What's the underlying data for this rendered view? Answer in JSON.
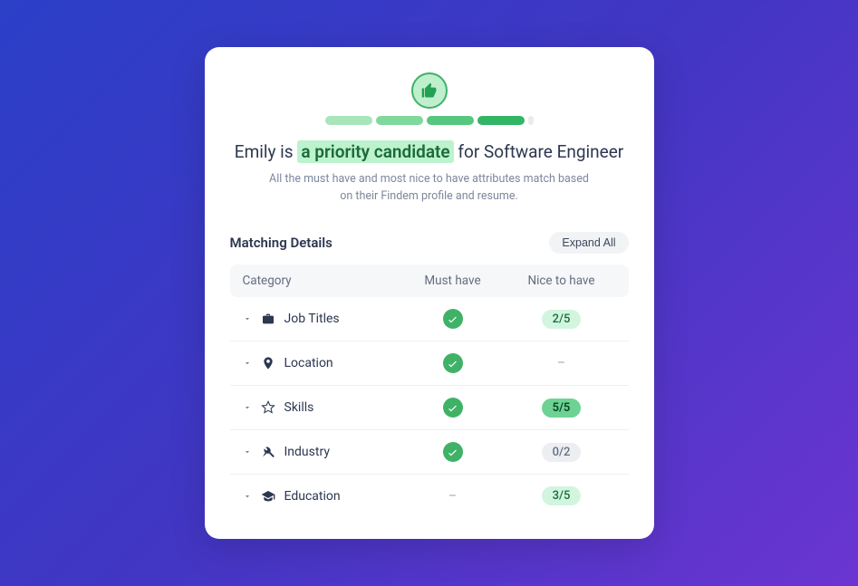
{
  "headline": {
    "prefix": "Emily is",
    "highlight": "a priority candidate",
    "suffix": "for Software Engineer"
  },
  "subtitle": "All the must have and most nice to have attributes match based on their Findem profile and resume.",
  "segment_colors": [
    "#a8e6ba",
    "#7fd99c",
    "#55c77e",
    "#33b566"
  ],
  "details_title": "Matching Details",
  "expand_all": "Expand All",
  "columns": {
    "category": "Category",
    "must_have": "Must have",
    "nice_to_have": "Nice to have"
  },
  "rows": [
    {
      "icon": "briefcase",
      "label": "Job Titles",
      "must": "check",
      "nice_type": "pill-light",
      "nice_val": "2/5"
    },
    {
      "icon": "pin",
      "label": "Location",
      "must": "check",
      "nice_type": "dash",
      "nice_val": "–"
    },
    {
      "icon": "star",
      "label": "Skills",
      "must": "check",
      "nice_type": "pill-strong",
      "nice_val": "5/5"
    },
    {
      "icon": "tools",
      "label": "Industry",
      "must": "check",
      "nice_type": "pill-gray",
      "nice_val": "0/2"
    },
    {
      "icon": "grad",
      "label": "Education",
      "must": "dash",
      "nice_type": "pill-light",
      "nice_val": "3/5"
    }
  ]
}
